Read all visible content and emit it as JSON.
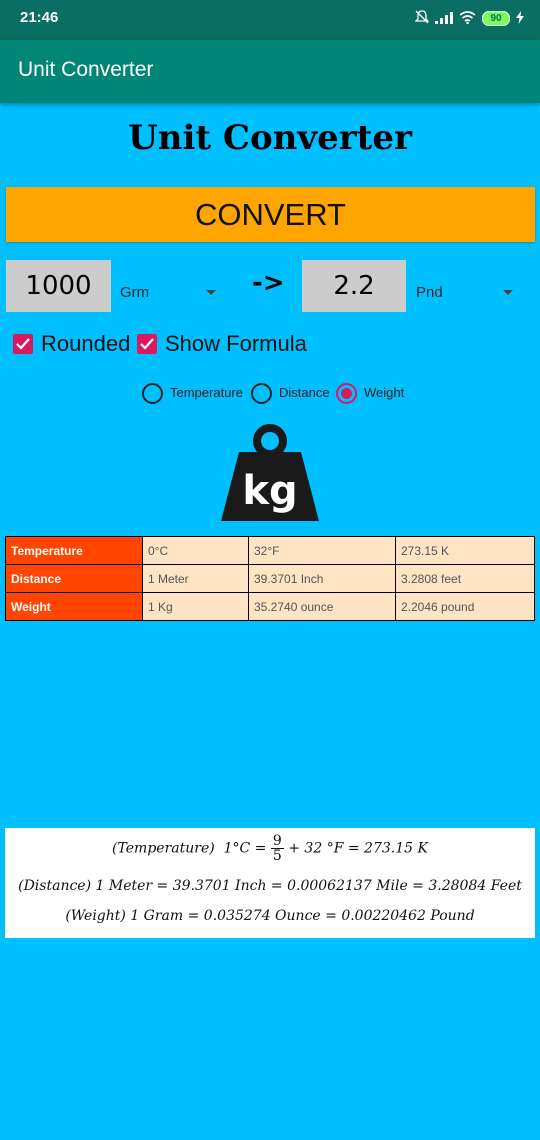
{
  "status_bar": {
    "time": "21:46",
    "battery": "90"
  },
  "app_bar": {
    "title": "Unit Converter"
  },
  "page_title": "Unit Converter",
  "convert_button": "CONVERT",
  "input": {
    "value": "1000",
    "unit": "Grm"
  },
  "arrow": "->",
  "output": {
    "value": "2.2",
    "unit": "Pnd"
  },
  "checkboxes": [
    {
      "label": "Rounded",
      "checked": true
    },
    {
      "label": "Show Formula",
      "checked": true
    }
  ],
  "radios": [
    {
      "label": "Temperature",
      "checked": false
    },
    {
      "label": "Distance",
      "checked": false
    },
    {
      "label": "Weight",
      "checked": true
    }
  ],
  "weight_icon": {
    "icon": "kg-weight-icon",
    "text": "kg"
  },
  "table": {
    "rows": [
      {
        "name": "Temperature",
        "cells": [
          "0°C",
          "32°F",
          "273.15 K"
        ]
      },
      {
        "name": "Distance",
        "cells": [
          "1 Meter",
          "39.3701 Inch",
          "3.2808 feet"
        ]
      },
      {
        "name": "Weight",
        "cells": [
          "1 Kg",
          "35.2740 ounce",
          "2.2046 pound"
        ]
      }
    ]
  },
  "formulas": {
    "temperature": {
      "label": "(Temperature)",
      "lhs": "1°C =",
      "num": "9",
      "den": "5",
      "rhs": "+ 32 °F = 273.15 K"
    },
    "distance": "(Distance) 1 Meter = 39.3701 Inch = 0.00062137 Mile =  3.28084 Feet",
    "weight": "(Weight) 1 Gram = 0.035274 Ounce = 0.00220462 Pound"
  },
  "colors": {
    "background": "#00BFFF",
    "app_bar": "#008577",
    "status_bar": "#0B6E62",
    "button": "#FFA500",
    "accent": "#D81B60",
    "table_header": "#FF4500",
    "table_cell": "#FFE4C4"
  }
}
